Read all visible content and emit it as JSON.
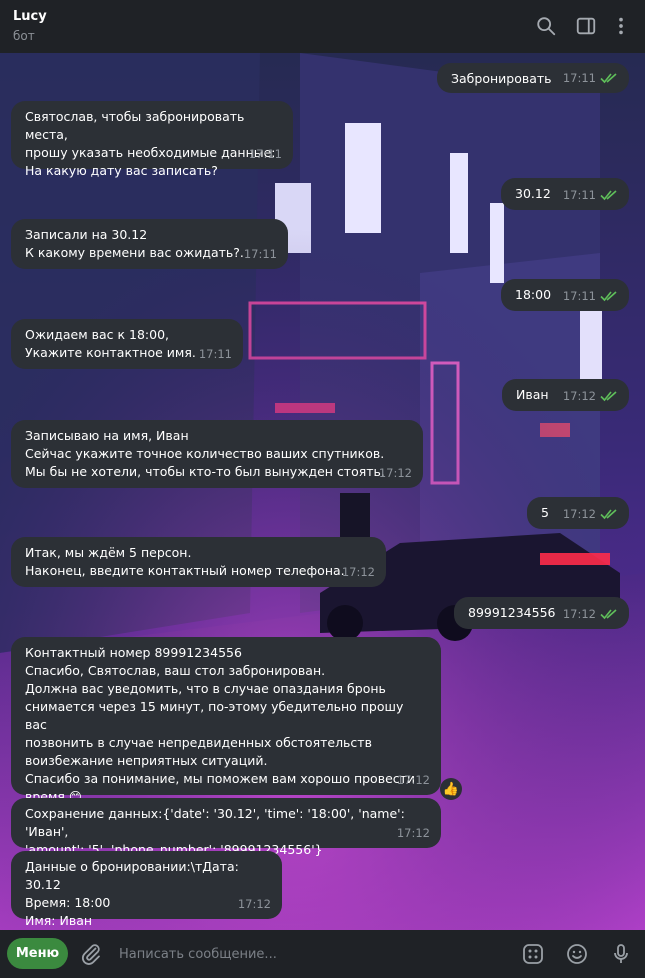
{
  "header": {
    "title": "Lucy",
    "subtitle": "бот",
    "icons": [
      "search-icon",
      "sidebar-toggle-icon",
      "more-vertical-icon"
    ]
  },
  "messages": [
    {
      "dir": "out",
      "text": "Забронировать",
      "time": "17:11",
      "status": "read"
    },
    {
      "dir": "in",
      "text": "Святослав, чтобы забронировать места,\nпрошу указать необходимые данные:\nНа какую дату вас записать?",
      "time": "17:11"
    },
    {
      "dir": "out",
      "text": "30.12",
      "time": "17:11",
      "status": "read"
    },
    {
      "dir": "in",
      "text": "Записали на 30.12\nК какому времени вас ожидать?.",
      "time": "17:11"
    },
    {
      "dir": "out",
      "text": "18:00",
      "time": "17:11",
      "status": "read"
    },
    {
      "dir": "in",
      "text": "Ожидаем вас к 18:00,\nУкажите контактное имя.",
      "time": "17:11"
    },
    {
      "dir": "out",
      "text": "Иван",
      "time": "17:12",
      "status": "read"
    },
    {
      "dir": "in",
      "text": "Записываю на имя, Иван\nСейчас укажите точное количество ваших спутников.\nМы бы не хотели, чтобы кто-то был вынужден стоять.",
      "time": "17:12"
    },
    {
      "dir": "out",
      "text": "5",
      "time": "17:12",
      "status": "read"
    },
    {
      "dir": "in",
      "text": "Итак, мы ждём 5 персон.\nНаконец, введите контактный номер телефона.",
      "time": "17:12"
    },
    {
      "dir": "out",
      "text": "89991234556",
      "time": "17:12",
      "status": "read"
    },
    {
      "dir": "in",
      "text": "Контактный номер 89991234556\nСпасибо, Святослав, ваш стол забронирован.\nДолжна вас уведомить, что в случае опаздания бронь\nснимается через 15 минут, по-этому убедительно прошу вас\nпозвонить в случае непредвиденных обстоятельств\nвоизбежание неприятных ситуаций.\nСпасибо за понимание, мы поможем вам хорошо провести\nвремя 😊",
      "time": "17:12",
      "reaction": "👍"
    },
    {
      "dir": "in",
      "text": "Сохранение данных:{'date': '30.12', 'time': '18:00', 'name': 'Иван',\n'amount': '5', 'phone_number': '89991234556'}",
      "time": "17:12"
    },
    {
      "dir": "in",
      "text": "Данные о бронировании:\\тДата: 30.12\nВремя: 18:00\nИмя: Иван",
      "time": "17:12"
    }
  ],
  "input": {
    "menu_label": "Меню",
    "placeholder": "Написать сообщение...",
    "icons": [
      "attach-icon",
      "bot-commands-icon",
      "emoji-icon",
      "microphone-icon"
    ]
  },
  "colors": {
    "header_bg": "#1f2226",
    "bubble_bg": "#2c3036",
    "read_tick": "#5fbf5a",
    "menu_button": "#3b8a3f",
    "time_text": "#8d939a"
  }
}
